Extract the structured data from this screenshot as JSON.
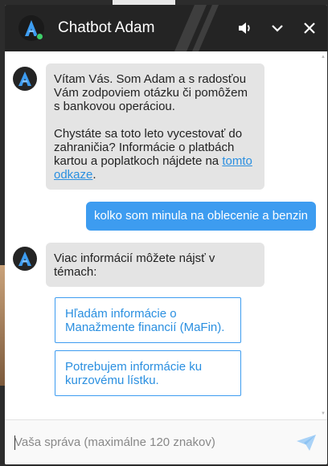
{
  "header": {
    "title": "Chatbot Adam",
    "logo_icon": "adam-logo-icon",
    "status": "online",
    "sound_icon": "speaker-icon",
    "minimize_icon": "chevron-down-icon",
    "close_icon": "close-icon"
  },
  "messages": {
    "bot_welcome": {
      "para1": "Vítam Vás. Som Adam a s radosťou Vám zodpoviem otázku či pomôžem s bankovou operáciou.",
      "para2_before": "Chystáte sa toto leto vycestovať do zahraničia? Informácie o platbách kartou a poplatkoch nájdete na ",
      "para2_link": "tomto odkaze",
      "para2_after": "."
    },
    "user_1": "kolko som minula na oblecenie a benzin",
    "bot_reply": "Viac informácií môžete nájsť v témach:",
    "options": [
      "Hľadám informácie o Manažmente financií (MaFin).",
      "Potrebujem informácie ku kurzovému lístku."
    ]
  },
  "composer": {
    "placeholder": "Vaša správa (maximálne 120 znakov)",
    "value": "",
    "send_icon": "send-icon"
  },
  "colors": {
    "header_bg": "#242424",
    "accent": "#3d9cf0",
    "bot_bubble": "#e4e4e4",
    "status_green": "#3ecf6a"
  }
}
